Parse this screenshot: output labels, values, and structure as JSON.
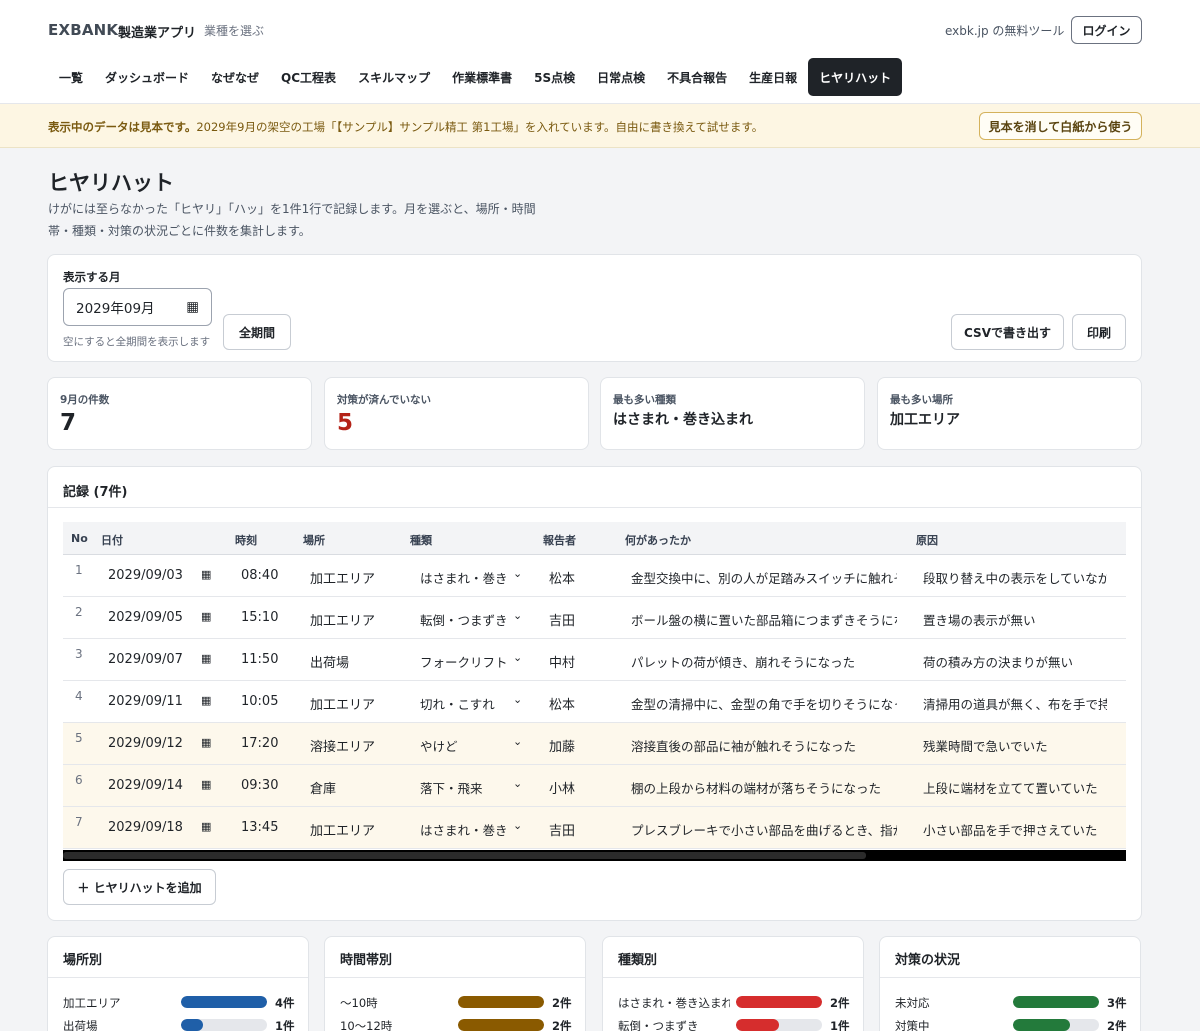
{
  "header": {
    "brand": "EXBANK",
    "app_name": "製造業アプリ",
    "choose_industry": "業種を選ぶ",
    "free_tools": "exbk.jp の無料ツール",
    "login": "ログイン"
  },
  "nav": [
    {
      "label": "一覧",
      "active": false
    },
    {
      "label": "ダッシュボード",
      "active": false
    },
    {
      "label": "なぜなぜ",
      "active": false
    },
    {
      "label": "QC工程表",
      "active": false
    },
    {
      "label": "スキルマップ",
      "active": false
    },
    {
      "label": "作業標準書",
      "active": false
    },
    {
      "label": "5S点検",
      "active": false
    },
    {
      "label": "日常点検",
      "active": false
    },
    {
      "label": "不具合報告",
      "active": false
    },
    {
      "label": "生産日報",
      "active": false
    },
    {
      "label": "ヒヤリハット",
      "active": true
    }
  ],
  "banner": {
    "bold": "表示中のデータは見本です。",
    "text": "2029年9月の架空の工場「【サンプル】サンプル精工 第1工場」を入れています。自由に書き換えて試せます。",
    "button": "見本を消して白紙から使う"
  },
  "page": {
    "title": "ヒヤリハット",
    "desc": "けがには至らなかった「ヒヤリ」「ハッ」を1件1行で記録します。月を選ぶと、場所・時間帯・種類・対策の状況ごとに件数を集計します。"
  },
  "filter": {
    "label": "表示する月",
    "month": "2029年09月",
    "hint": "空にすると全期間を表示します",
    "all_period": "全期間",
    "csv": "CSVで書き出す",
    "print": "印刷"
  },
  "stats": [
    {
      "label": "9月の件数",
      "value": "7"
    },
    {
      "label": "対策が済んでいない",
      "value": "5"
    },
    {
      "label": "最も多い種類",
      "value": "はさまれ・巻き込まれ"
    },
    {
      "label": "最も多い場所",
      "value": "加工エリア"
    }
  ],
  "records": {
    "title": "記録 (7件)",
    "columns": [
      "No",
      "日付",
      "時刻",
      "場所",
      "種類",
      "報告者",
      "何があったか",
      "原因"
    ],
    "rows": [
      {
        "no": "1",
        "date": "2029/09/03",
        "time": "08:40",
        "place": "加工エリア",
        "kind": "はさまれ・巻き込まれ",
        "reporter": "松本",
        "what": "金型交換中に、別の人が足踏みスイッチに触れそうになった",
        "cause": "段取り替え中の表示をしていなかった",
        "hl": false
      },
      {
        "no": "2",
        "date": "2029/09/05",
        "time": "15:10",
        "place": "加工エリア",
        "kind": "転倒・つまずき",
        "reporter": "吉田",
        "what": "ボール盤の横に置いた部品箱につまずきそうになった",
        "cause": "置き場の表示が無い",
        "hl": false
      },
      {
        "no": "3",
        "date": "2029/09/07",
        "time": "11:50",
        "place": "出荷場",
        "kind": "フォークリフト・車両",
        "reporter": "中村",
        "what": "パレットの荷が傾き、崩れそうになった",
        "cause": "荷の積み方の決まりが無い",
        "hl": false
      },
      {
        "no": "4",
        "date": "2029/09/11",
        "time": "10:05",
        "place": "加工エリア",
        "kind": "切れ・こすれ",
        "reporter": "松本",
        "what": "金型の清掃中に、金型の角で手を切りそうになった",
        "cause": "清掃用の道具が無く、布を手で持っていた",
        "hl": false
      },
      {
        "no": "5",
        "date": "2029/09/12",
        "time": "17:20",
        "place": "溶接エリア",
        "kind": "やけど",
        "reporter": "加藤",
        "what": "溶接直後の部品に袖が触れそうになった",
        "cause": "残業時間で急いでいた",
        "hl": true
      },
      {
        "no": "6",
        "date": "2029/09/14",
        "time": "09:30",
        "place": "倉庫",
        "kind": "落下・飛来",
        "reporter": "小林",
        "what": "棚の上段から材料の端材が落ちそうになった",
        "cause": "上段に端材を立てて置いていた",
        "hl": true
      },
      {
        "no": "7",
        "date": "2029/09/18",
        "time": "13:45",
        "place": "加工エリア",
        "kind": "はさまれ・巻き込まれ",
        "reporter": "吉田",
        "what": "プレスブレーキで小さい部品を曲げるとき、指が近づいた",
        "cause": "小さい部品を手で押さえていた",
        "hl": true
      }
    ],
    "add_button": "＋ ヒヤリハットを追加"
  },
  "summaries": [
    {
      "title": "場所別",
      "color": "#1f5fa8",
      "rows": [
        {
          "label": "加工エリア",
          "count": "4件",
          "value": 4
        },
        {
          "label": "出荷場",
          "count": "1件",
          "value": 1
        }
      ]
    },
    {
      "title": "時間帯別",
      "color": "#8a5a00",
      "rows": [
        {
          "label": "〜10時",
          "count": "2件",
          "value": 2
        },
        {
          "label": "10〜12時",
          "count": "2件",
          "value": 2
        }
      ]
    },
    {
      "title": "種類別",
      "color": "#d62d2d",
      "rows": [
        {
          "label": "はさまれ・巻き込まれ",
          "count": "2件",
          "value": 2
        },
        {
          "label": "転倒・つまずき",
          "count": "1件",
          "value": 1
        }
      ]
    },
    {
      "title": "対策の状況",
      "color": "#237a3b",
      "rows": [
        {
          "label": "未対応",
          "count": "3件",
          "value": 3
        },
        {
          "label": "対策中",
          "count": "2件",
          "value": 2
        }
      ]
    }
  ]
}
